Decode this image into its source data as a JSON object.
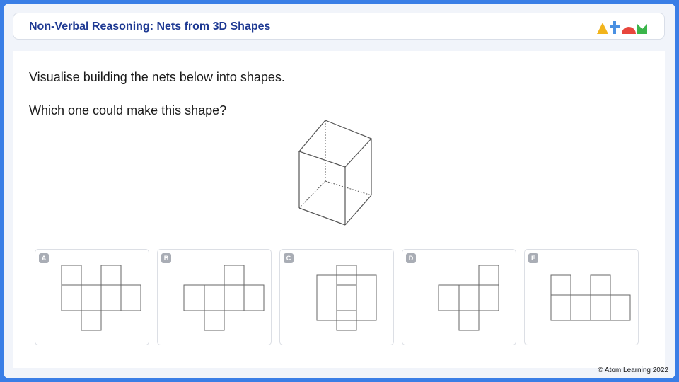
{
  "header": {
    "title": "Non-Verbal Reasoning: Nets from 3D Shapes"
  },
  "logo": {
    "icon": "atom-logo-icon",
    "colors": {
      "triangle": "#f2b41c",
      "t": "#4a90e2",
      "o": "#e8453c",
      "m": "#3bb54a"
    }
  },
  "question": {
    "line1": "Visualise building the nets below into shapes.",
    "line2": "Which one could make this shape?"
  },
  "options": [
    {
      "label": "A"
    },
    {
      "label": "B"
    },
    {
      "label": "C"
    },
    {
      "label": "D"
    },
    {
      "label": "E"
    }
  ],
  "footer": {
    "copyright": "© Atom Learning 2022"
  },
  "colors": {
    "background": "#3a7ee6",
    "title": "#1f3a93",
    "badge": "#a9adb5",
    "net_stroke": "#666666"
  }
}
